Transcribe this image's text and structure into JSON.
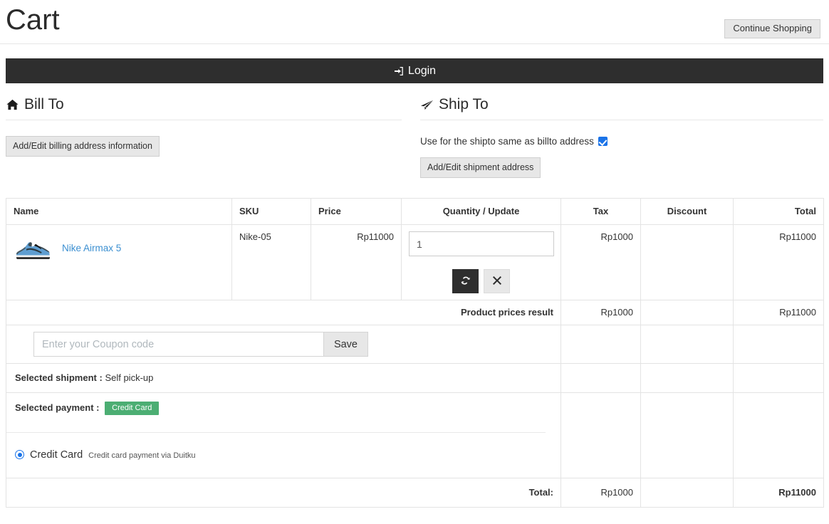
{
  "header": {
    "title": "Cart",
    "continue_shopping_label": "Continue Shopping"
  },
  "login_bar": {
    "label": "Login",
    "icon": "sign-in-icon",
    "background": "#2e2e2e"
  },
  "bill_to": {
    "heading": "Bill To",
    "icon": "home-icon",
    "button_label": "Add/Edit billing address information"
  },
  "ship_to": {
    "heading": "Ship To",
    "icon": "paper-plane-icon",
    "same_as_billto_label": "Use for the shipto same as billto address",
    "same_as_billto_checked": true,
    "button_label": "Add/Edit shipment address"
  },
  "cart_table": {
    "columns": [
      "Name",
      "SKU",
      "Price",
      "Quantity / Update",
      "Tax",
      "Discount",
      "Total"
    ],
    "items": [
      {
        "name": "Nike Airmax 5",
        "sku": "Nike-05",
        "price": "Rp11000",
        "quantity": "1",
        "tax": "Rp1000",
        "discount": "",
        "total": "Rp11000",
        "thumbnail": "sneaker-image",
        "update_icon": "refresh-icon",
        "remove_icon": "close-icon"
      }
    ],
    "result_row": {
      "label": "Product prices result",
      "tax": "Rp1000",
      "discount": "",
      "total": "Rp11000"
    },
    "coupon": {
      "placeholder": "Enter your Coupon code",
      "value": "",
      "save_label": "Save"
    },
    "selected_shipment": {
      "label": "Selected shipment :",
      "value": "Self pick-up"
    },
    "selected_payment": {
      "label": "Selected payment :",
      "badge": "Credit Card",
      "badge_color": "#4cae73"
    },
    "payment_options": [
      {
        "name": "Credit Card",
        "description": "Credit card payment via Duitku",
        "selected": true
      }
    ],
    "footer": {
      "label": "Total:",
      "tax": "Rp1000",
      "discount": "",
      "total": "Rp11000"
    }
  }
}
